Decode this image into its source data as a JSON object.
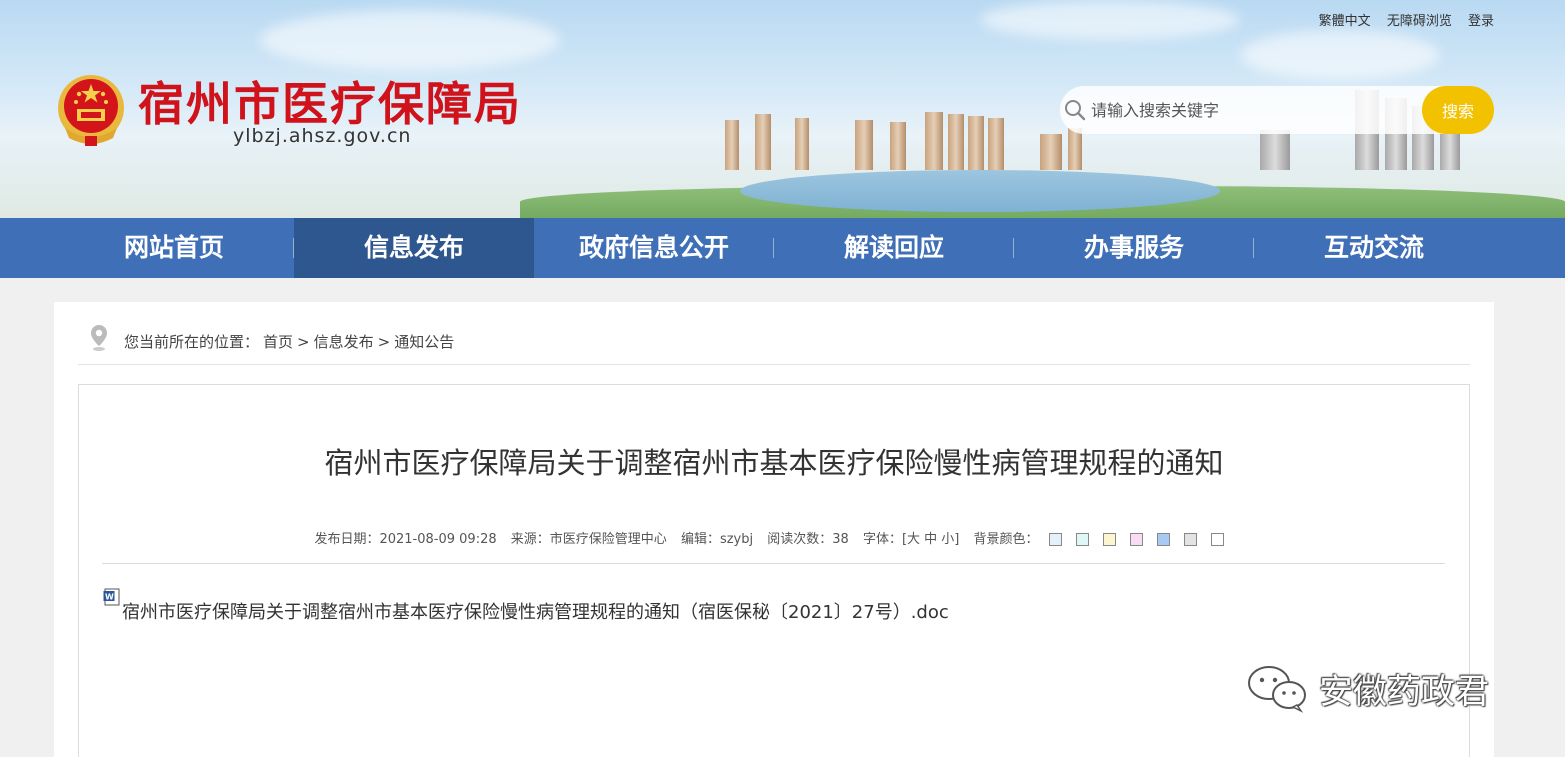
{
  "header": {
    "site_name": "宿州市医疗保障局",
    "domain": "ylbzj.ahsz.gov.cn",
    "top_links": [
      "繁體中文",
      "无障碍浏览",
      "登录"
    ],
    "search": {
      "placeholder": "请输入搜索关键字",
      "button_label": "搜索"
    }
  },
  "nav": {
    "items": [
      {
        "label": "网站首页"
      },
      {
        "label": "信息发布"
      },
      {
        "label": "政府信息公开"
      },
      {
        "label": "解读回应"
      },
      {
        "label": "办事服务"
      },
      {
        "label": "互动交流"
      }
    ],
    "active_index": 1
  },
  "breadcrumb": {
    "prefix": "您当前所在的位置：",
    "items": [
      "首页",
      ">",
      "信息发布",
      ">",
      "通知公告"
    ]
  },
  "article": {
    "title": "宿州市医疗保障局关于调整宿州市基本医疗保险慢性病管理规程的通知",
    "meta": {
      "date_label": "发布日期：",
      "date": "2021-08-09 09:28",
      "source_label": "来源：",
      "source": "市医疗保险管理中心",
      "editor_label": "编辑：",
      "editor": "szybj",
      "views_label": "阅读次数：",
      "views": "38",
      "font_label": "字体：",
      "font_sizes": "[大 中 小]",
      "bg_label": "背景颜色："
    },
    "bg_colors": [
      "#e3f1fb",
      "#dff7f7",
      "#fbf6d0",
      "#f9dcf3",
      "#a7c9f3",
      "#e3e3e3",
      "#ffffff"
    ],
    "attachment": "宿州市医疗保障局关于调整宿州市基本医疗保险慢性病管理规程的通知（宿医保秘〔2021〕27号）.doc"
  },
  "watermark": {
    "text": "安徽药政君"
  },
  "colors": {
    "nav_bg": "#3f6fb6",
    "nav_active": "#2f578f",
    "brand_red": "#d0121b",
    "search_btn": "#f2c200"
  }
}
